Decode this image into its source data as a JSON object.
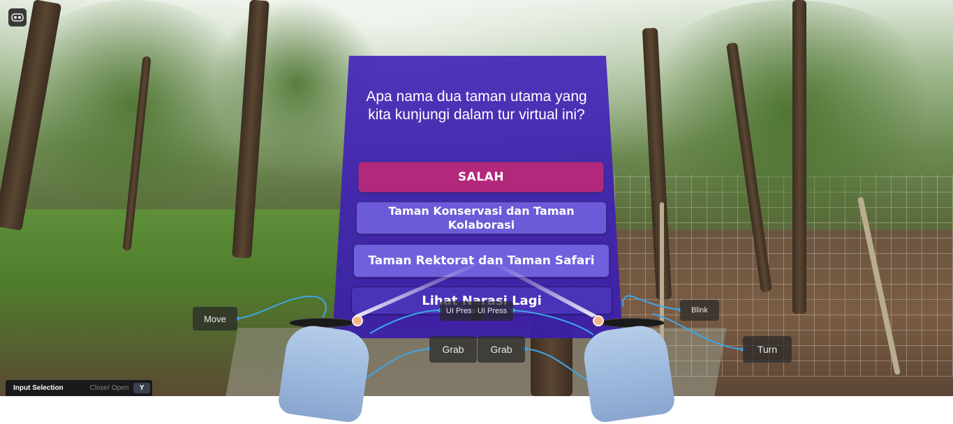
{
  "quiz": {
    "question": "Apa nama dua taman utama yang kita kunjungi dalam tur virtual ini?",
    "feedback": "SALAH",
    "options": [
      "Taman Konservasi dan Taman Kolaborasi",
      "Taman Rektorat dan Taman Safari",
      "Lihat Narasi Lagi"
    ],
    "colors": {
      "panel": "#4a28b8",
      "feedback": "#b2287a",
      "option": "#6b5bd8"
    }
  },
  "controller_hints": {
    "left": {
      "move": "Move",
      "ui_press": "UI Press",
      "grab": "Grab"
    },
    "right": {
      "ui_press": "UI Press",
      "grab": "Grab",
      "blink": "Blink",
      "turn": "Turn"
    }
  },
  "input_selection": {
    "title": "Input Selection",
    "action": "Close/ Open",
    "key": "Y"
  },
  "icons": {
    "top_left": "vr-headset-icon"
  }
}
